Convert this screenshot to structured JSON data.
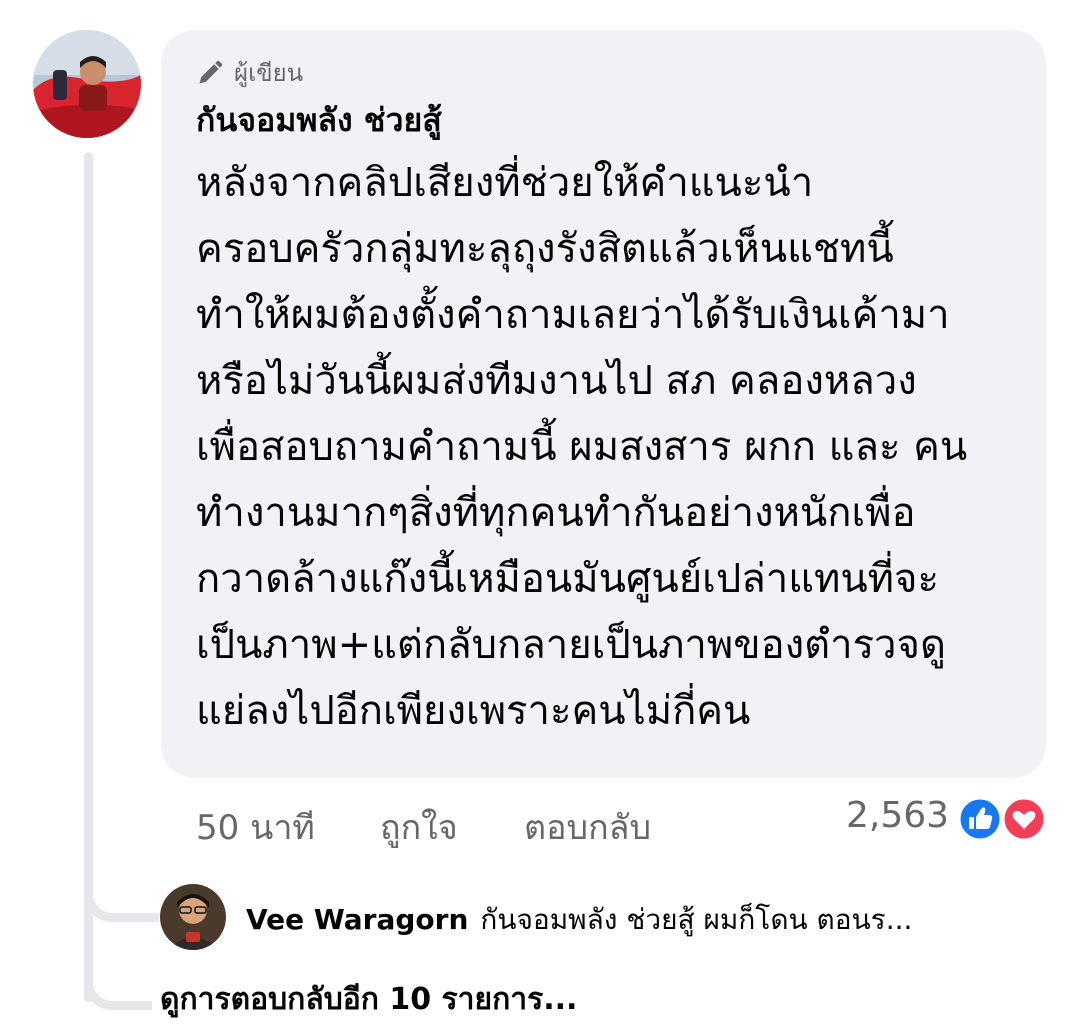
{
  "comment": {
    "badge_label": "ผู้เขียน",
    "author_name": "กันจอมพลัง ช่วยสู้",
    "lines": [
      "หลังจากคลิปเสียงที่ช่วยให้คำแนะนำ",
      "ครอบครัวกลุ่มทะลุถุงรังสิตแล้วเห็นแชทนี้",
      "ทำให้ผมต้องตั้งคำถามเลยว่าได้รับเงินเค้ามา",
      "หรือไม่วันนี้ผมส่งทีมงานไป สภ คลองหลวง",
      "เพื่อสอบถามคำถามนี้ ผมสงสาร ผกก และ คน",
      "ทำงานมากๆสิ่งที่ทุกคนทำกันอย่างหนักเพื่อ",
      "กวาดล้างแก๊งนี้เหมือนมันศูนย์เปล่าแทนที่จะ",
      "เป็นภาพ+แต่กลับกลายเป็นภาพของตำรวจดู",
      "แย่ลงไปอีกเพียงเพราะคนไม่กี่คน"
    ],
    "time_label": "50 นาที",
    "like_label": "ถูกใจ",
    "reply_label": "ตอบกลับ",
    "reaction_count": "2,563",
    "reaction_icons": [
      "like-reaction-icon",
      "love-reaction-icon"
    ]
  },
  "reply_preview": {
    "author_name": "Vee Waragorn",
    "snippet": "กันจอมพลัง ช่วยสู้ ผมก็โดน ตอนร..."
  },
  "more_replies_label": "ดูการตอบกลับอีก 10 รายการ...",
  "colors": {
    "bubble": "#f0f2f5",
    "secondary_text": "#65676b",
    "like_blue": "#1877f2",
    "love_red": "#f33e58"
  }
}
